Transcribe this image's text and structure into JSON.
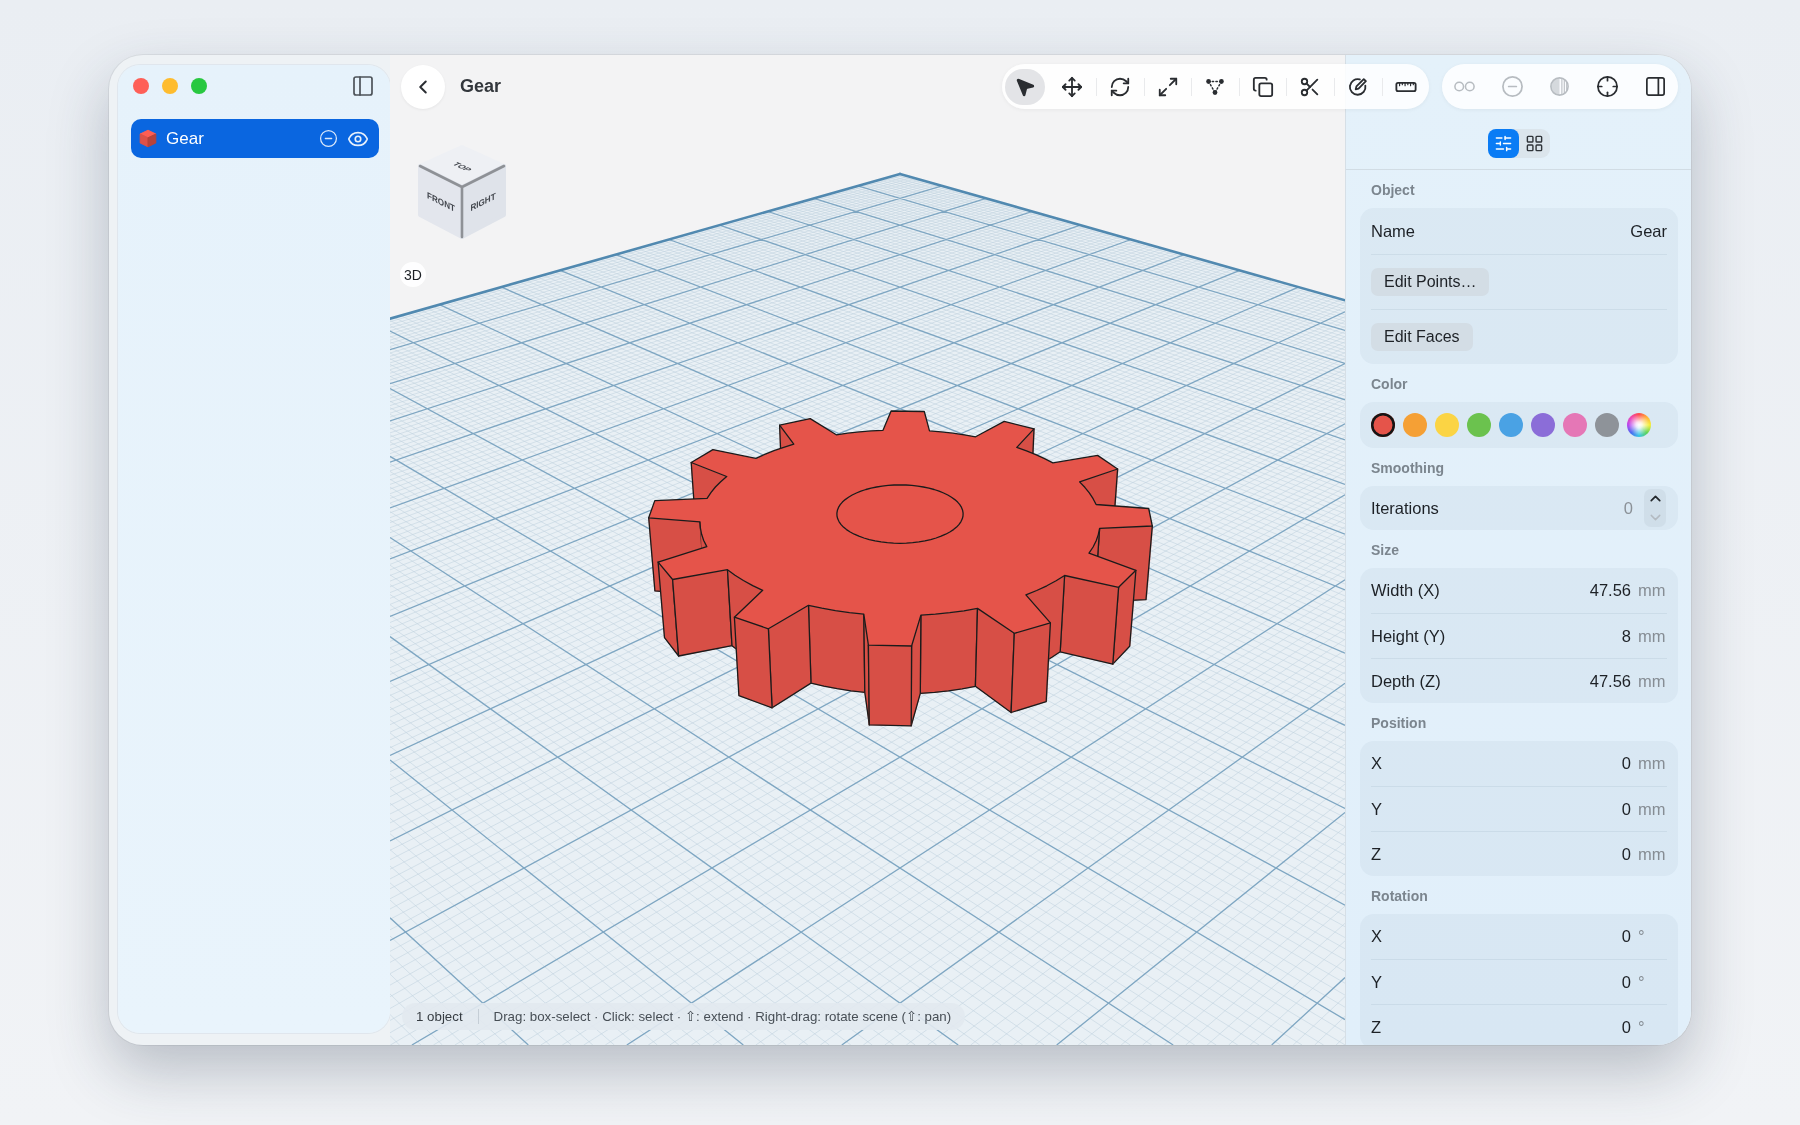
{
  "sidebar": {
    "items": [
      {
        "label": "Gear",
        "selected": true,
        "visible": true
      }
    ]
  },
  "header": {
    "title": "Gear"
  },
  "toolbar": {
    "tools": [
      {
        "kind": "select",
        "selected": true
      },
      {
        "kind": "move",
        "selected": false
      },
      {
        "kind": "rotate",
        "selected": false
      },
      {
        "kind": "scale",
        "selected": false
      },
      {
        "kind": "vertices",
        "selected": false
      },
      {
        "kind": "duplicate",
        "selected": false
      },
      {
        "kind": "cut",
        "selected": false
      },
      {
        "kind": "sketch",
        "selected": false
      },
      {
        "kind": "measure",
        "selected": false
      }
    ],
    "view_tools": [
      {
        "kind": "pair",
        "disabled": true
      },
      {
        "kind": "remove",
        "disabled": true
      },
      {
        "kind": "shade",
        "disabled": true
      },
      {
        "kind": "center",
        "disabled": false
      },
      {
        "kind": "inspector",
        "disabled": false
      }
    ]
  },
  "viewport": {
    "view_cube": [
      {
        "kind": "top",
        "label": "TOP"
      },
      {
        "kind": "front",
        "label": "FRONT"
      },
      {
        "kind": "right",
        "label": "RIGHT"
      }
    ],
    "view_mode": "3D",
    "status_bar": {
      "count": "1 object",
      "hint": "Drag: box-select · Click: select · ⇧: extend · Right-drag: rotate scene (⇧: pan)"
    }
  },
  "inspector": {
    "tabs": [
      {
        "kind": "properties",
        "selected": true
      },
      {
        "kind": "grid",
        "selected": false
      }
    ],
    "sections": [
      {
        "title": "Object",
        "rows": [
          {
            "kind": "text",
            "label": "Name",
            "value": "Gear"
          },
          {
            "kind": "button",
            "label": "Edit Points…"
          },
          {
            "kind": "button",
            "label": "Edit Faces"
          }
        ]
      },
      {
        "title": "Color",
        "rows": [
          {
            "kind": "swatches",
            "swatches": [
              {
                "kind": "solid",
                "color": "#e5544a",
                "selected": true
              },
              {
                "kind": "solid",
                "color": "#f5a035",
                "selected": false
              },
              {
                "kind": "solid",
                "color": "#fbd444",
                "selected": false
              },
              {
                "kind": "solid",
                "color": "#6bc24e",
                "selected": false
              },
              {
                "kind": "solid",
                "color": "#4aa2e4",
                "selected": false
              },
              {
                "kind": "solid",
                "color": "#8b6dd8",
                "selected": false
              },
              {
                "kind": "solid",
                "color": "#e577b6",
                "selected": false
              },
              {
                "kind": "solid",
                "color": "#8e9399",
                "selected": false
              },
              {
                "kind": "spectrum",
                "selected": false
              }
            ]
          }
        ]
      },
      {
        "title": "Smoothing",
        "rows": [
          {
            "kind": "stepper",
            "label": "Iterations",
            "value": "0",
            "up_disabled": false,
            "down_disabled": true
          }
        ]
      },
      {
        "title": "Size",
        "rows": [
          {
            "kind": "measure",
            "label": "Width (X)",
            "value": "47.56",
            "unit": "mm"
          },
          {
            "kind": "measure",
            "label": "Height (Y)",
            "value": "8",
            "unit": "mm"
          },
          {
            "kind": "measure",
            "label": "Depth (Z)",
            "value": "47.56",
            "unit": "mm"
          }
        ]
      },
      {
        "title": "Position",
        "rows": [
          {
            "kind": "measure",
            "label": "X",
            "value": "0",
            "unit": "mm"
          },
          {
            "kind": "measure",
            "label": "Y",
            "value": "0",
            "unit": "mm"
          },
          {
            "kind": "measure",
            "label": "Z",
            "value": "0",
            "unit": "mm"
          }
        ]
      },
      {
        "title": "Rotation",
        "rows": [
          {
            "kind": "measure",
            "label": "X",
            "value": "0",
            "unit": "°"
          },
          {
            "kind": "measure",
            "label": "Y",
            "value": "0",
            "unit": "°"
          },
          {
            "kind": "measure",
            "label": "Z",
            "value": "0",
            "unit": "°"
          }
        ]
      }
    ]
  }
}
